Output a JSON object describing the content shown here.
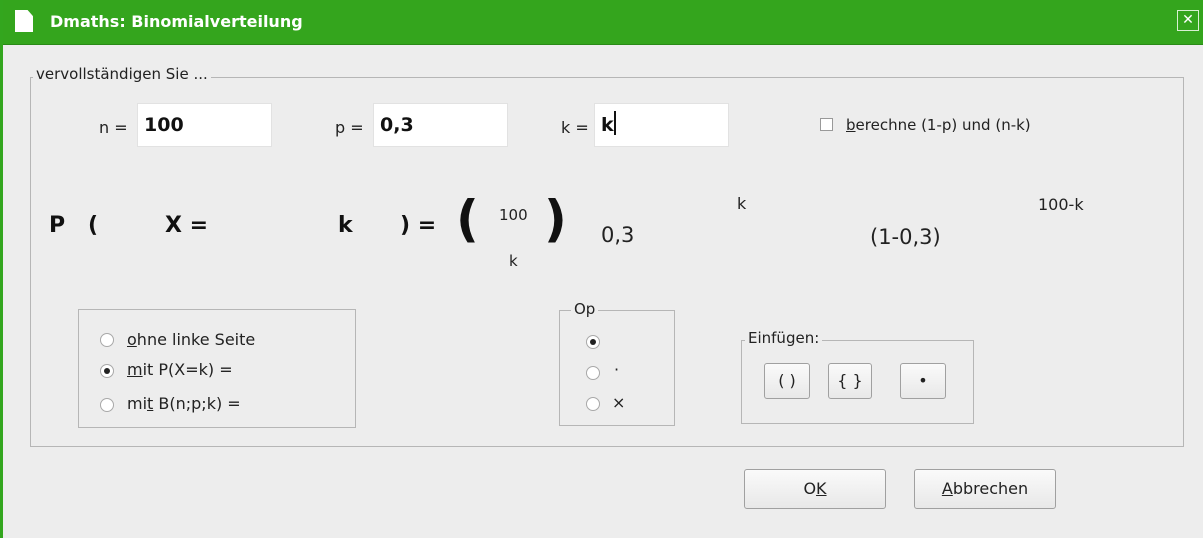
{
  "window": {
    "title": "Dmaths: Binomialverteilung",
    "close": "✕"
  },
  "fill_group": {
    "legend": "vervollständigen Sie ...",
    "n_label": "n =",
    "n_value": "100",
    "p_label": "p =",
    "p_value": "0,3",
    "k_label": "k =",
    "k_value": "k",
    "checkbox_prefix": "b",
    "checkbox_rest": "erechne (1-p) und (n-k)"
  },
  "formula": {
    "P": "P",
    "open_paren": "(",
    "X_eq": "X =",
    "k": "k",
    "close_eq": ") =",
    "big_open": "(",
    "binom_top": "100",
    "binom_bottom": "k",
    "big_close": ")",
    "base": "0,3",
    "exp_k": "k",
    "base2": "(1-0,3)",
    "exp_nk": "100-k"
  },
  "left_options": [
    {
      "key": "o",
      "rest": "hne linke Seite",
      "selected": false
    },
    {
      "key": "m",
      "rest": "it P(X=k) =",
      "selected": true
    },
    {
      "pre": "mi",
      "key": "t",
      "rest": " B(n;p;k) =",
      "selected": false
    }
  ],
  "op_group": {
    "legend": "Op",
    "options": [
      {
        "label": "",
        "selected": true
      },
      {
        "label": "·",
        "selected": false
      },
      {
        "label": "×",
        "selected": false
      }
    ]
  },
  "insert_group": {
    "legend": "Einfügen:",
    "buttons": [
      "( )",
      "{ }",
      "•"
    ]
  },
  "footer": {
    "ok_pre": "O",
    "ok_key": "K",
    "cancel_key": "A",
    "cancel_rest": "bbrechen"
  }
}
